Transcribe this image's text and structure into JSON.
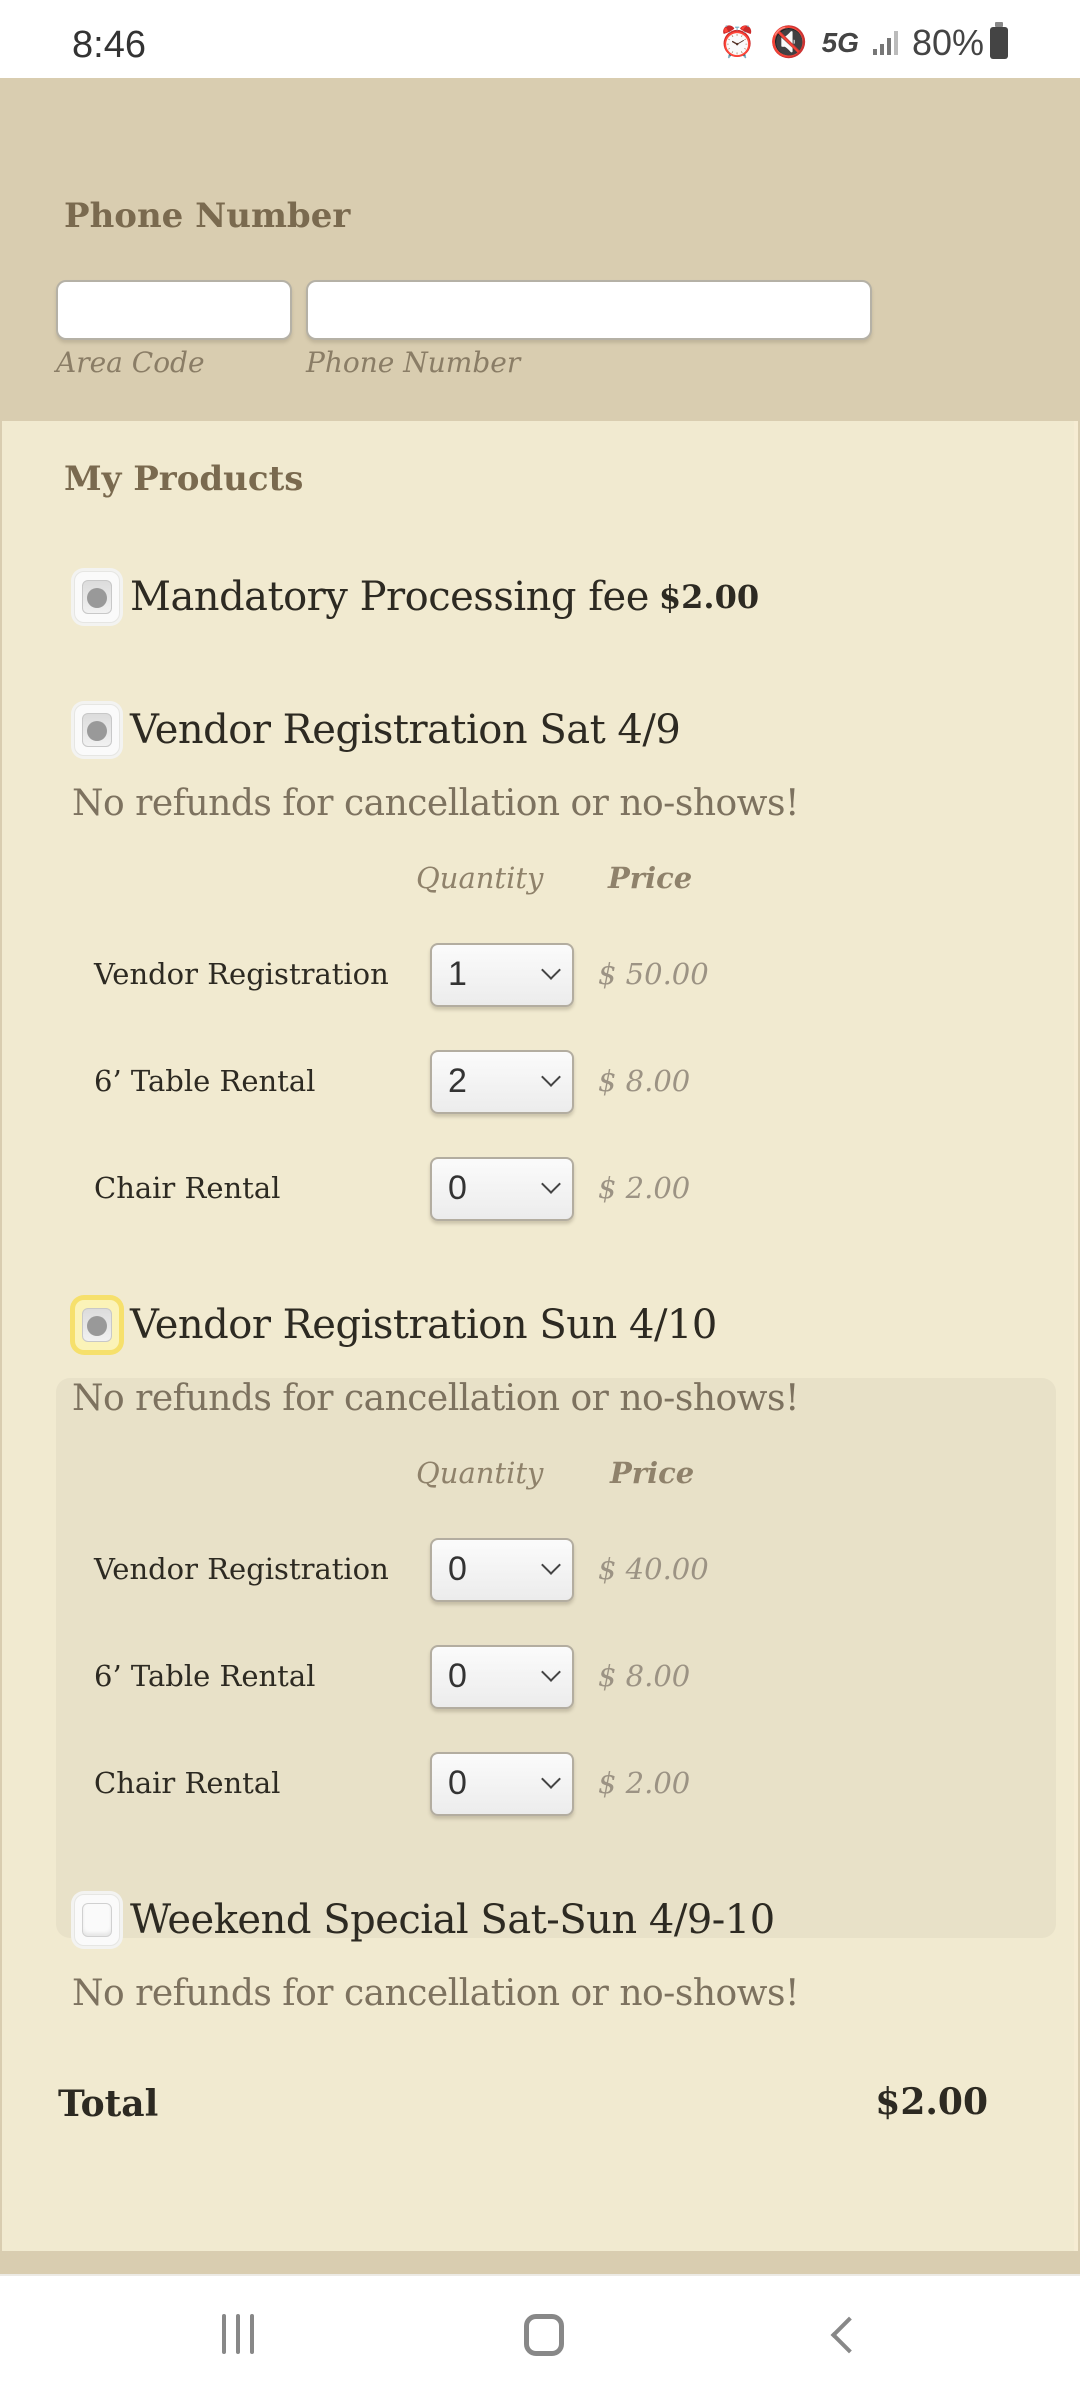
{
  "status_bar": {
    "time": "8:46",
    "icons": [
      "alarm-icon",
      "mute-icon",
      "5g-icon",
      "signal-icon"
    ],
    "network": "5G",
    "battery": "80%"
  },
  "phone_section": {
    "title": "Phone Number",
    "area_code": {
      "value": "",
      "sublabel": "Area Code"
    },
    "phone_number": {
      "value": "",
      "sublabel": "Phone Number"
    }
  },
  "products": {
    "title": "My Products",
    "quantity_header": "Quantity",
    "price_header": "Price",
    "items": [
      {
        "name": "Mandatory Processing fee",
        "price": "$2.00",
        "selected": true
      },
      {
        "name": "Vendor Registration Sat 4/9",
        "description": "No refunds for cancellation or no-shows!",
        "selected": true,
        "lines": [
          {
            "label": "Vendor Registration",
            "quantity": "1",
            "price": "$ 50.00"
          },
          {
            "label": "6’ Table Rental",
            "quantity": "2",
            "price": "$ 8.00"
          },
          {
            "label": "Chair Rental",
            "quantity": "0",
            "price": "$ 2.00"
          }
        ]
      },
      {
        "name": "Vendor Registration Sun 4/10",
        "description": "No refunds for cancellation or no-shows!",
        "selected": true,
        "focused": true,
        "lines": [
          {
            "label": "Vendor Registration",
            "quantity": "0",
            "price": "$ 40.00"
          },
          {
            "label": "6’ Table Rental",
            "quantity": "0",
            "price": "$ 8.00"
          },
          {
            "label": "Chair Rental",
            "quantity": "0",
            "price": "$ 2.00"
          }
        ]
      },
      {
        "name": "Weekend Special Sat-Sun 4/9-10",
        "description": "No refunds for cancellation or no-shows!",
        "selected": false
      }
    ],
    "total_label": "Total",
    "total_value": "$2.00"
  },
  "colors": {
    "page_background": "#d9cdb0",
    "card_background": "#f1ead0",
    "highlight_box": "#e8e1c8",
    "focus_ring": "#f6e06c",
    "label_color": "#7a6a4f"
  },
  "nav_bar": {
    "buttons": [
      "recents-button",
      "home-button",
      "back-button"
    ]
  }
}
